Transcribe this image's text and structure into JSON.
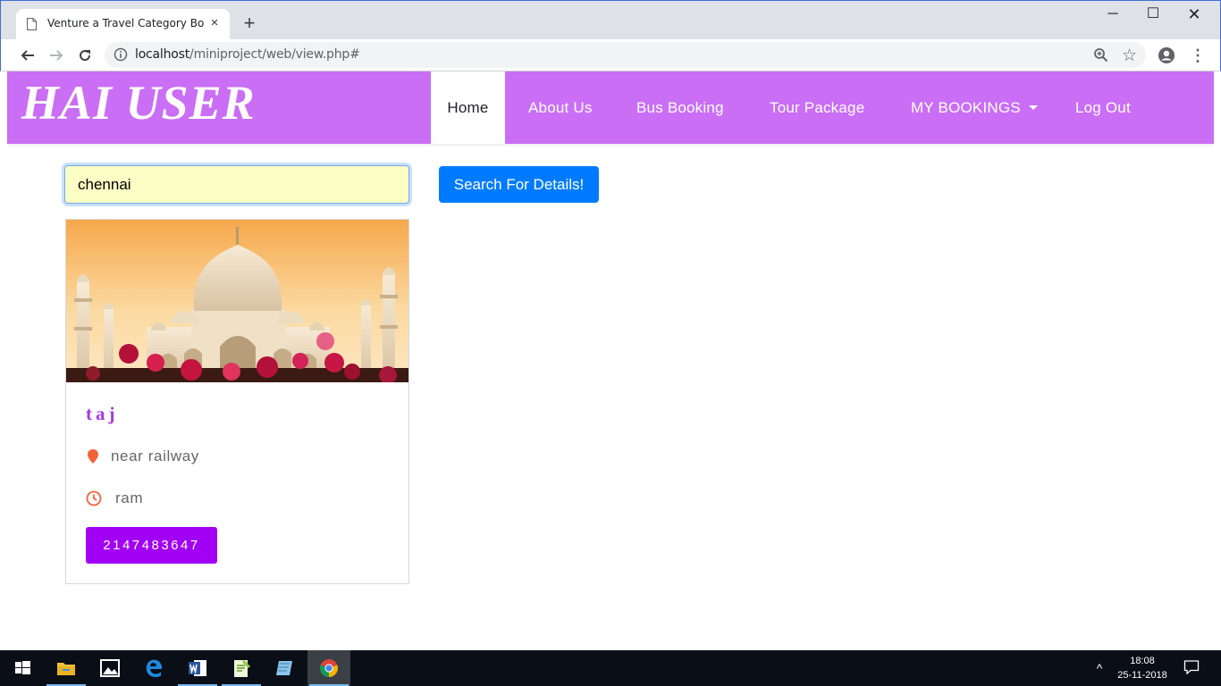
{
  "browser": {
    "tab_title": "Venture a Travel Category Bootstrap",
    "tab_close": "×",
    "new_tab": "+",
    "url_host": "localhost",
    "url_path": "/miniproject/web/view.php#",
    "menu_glyph": "⋮",
    "icons": [
      "page-icon",
      "info-icon",
      "zoom-icon",
      "star-icon",
      "account-icon",
      "menu-icon"
    ]
  },
  "window": {
    "min": "─",
    "max": "☐",
    "close": "✕"
  },
  "site": {
    "brand": "HAI USER",
    "bar_color": "#c96ef5",
    "nav": {
      "home": "Home",
      "about": "About Us",
      "bus": "Bus Booking",
      "tour": "Tour Package",
      "bookings": "MY BOOKINGS",
      "logout": "Log Out"
    }
  },
  "search": {
    "value": "chennai",
    "button": "Search For Details!"
  },
  "card": {
    "title": "taj",
    "location": "near railway",
    "time_label": "ram",
    "price_button": "2147483647",
    "accent": "#a200f5"
  },
  "taskbar": {
    "time": "18:08",
    "date": "25-11-2018",
    "tray_up": "^"
  }
}
